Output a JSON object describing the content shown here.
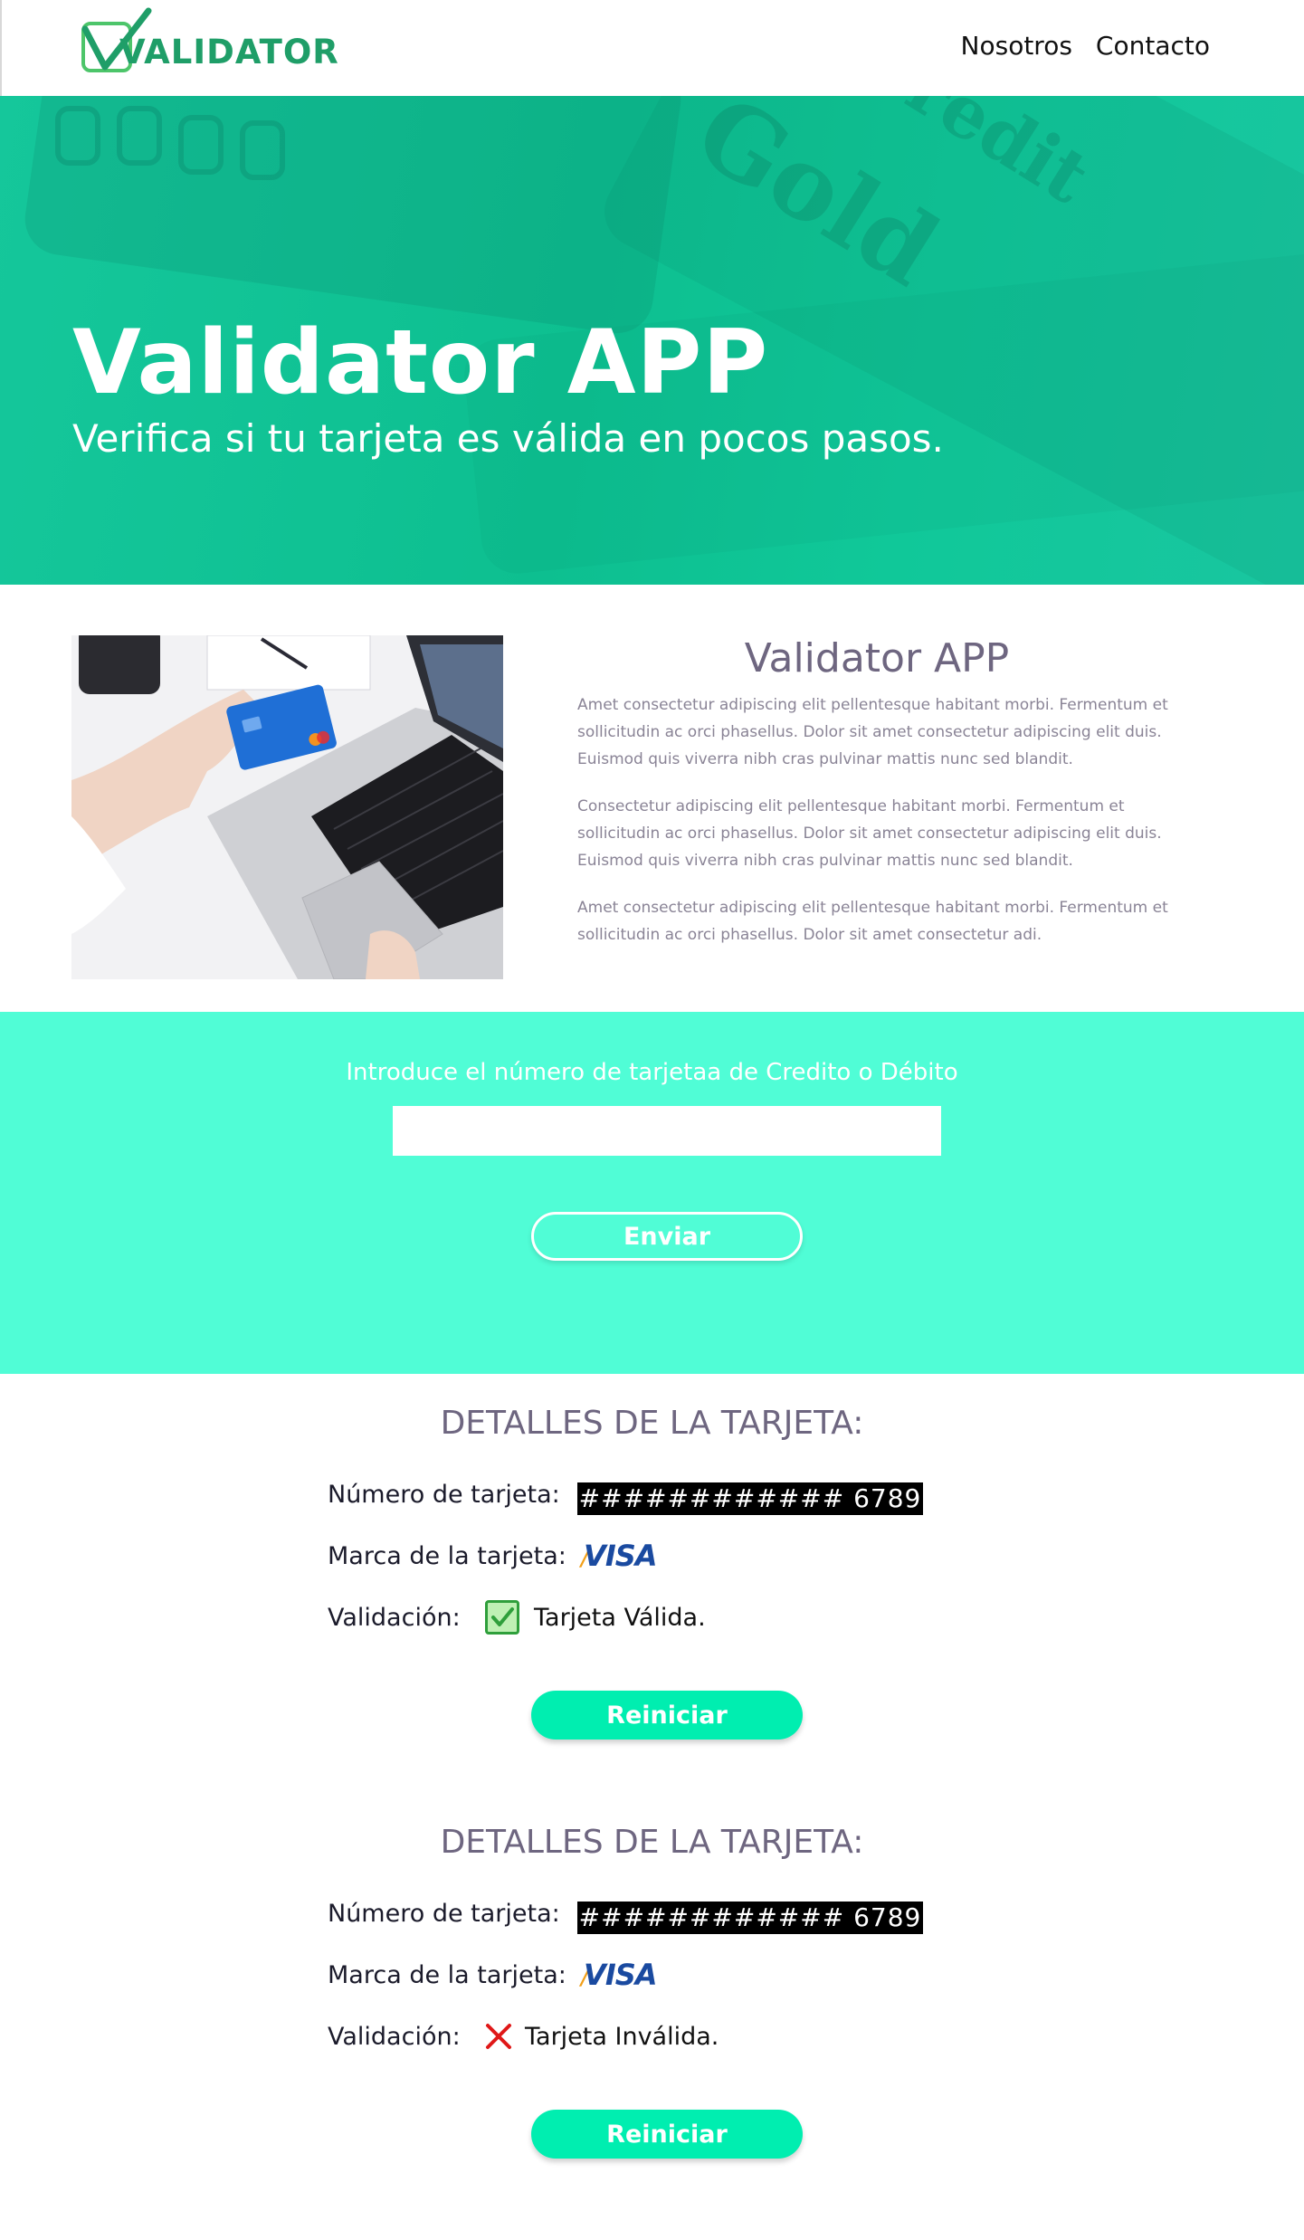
{
  "header": {
    "logo_text": "VALIDATOR",
    "nav": [
      "Nosotros",
      "Contacto"
    ]
  },
  "hero": {
    "title": "Validator APP",
    "subtitle": "Verifica si tu tarjeta es válida en pocos pasos.",
    "background_text": [
      "Gold",
      "credit"
    ]
  },
  "about": {
    "title": "Validator APP",
    "paragraphs": [
      "Amet consectetur adipiscing elit pellentesque habitant morbi. Fermentum et sollicitudin ac orci phasellus. Dolor sit amet consectetur adipiscing elit duis. Euismod quis viverra nibh cras pulvinar mattis nunc sed blandit.",
      "Consectetur adipiscing elit pellentesque habitant morbi. Fermentum et sollicitudin ac orci phasellus. Dolor sit amet consectetur adipiscing elit duis. Euismod quis viverra nibh cras pulvinar mattis nunc sed blandit.",
      "Amet consectetur adipiscing elit pellentesque habitant morbi. Fermentum et sollicitudin ac orci phasellus. Dolor sit amet consectetur adi."
    ]
  },
  "form": {
    "label": "Introduce el número de tarjetaa de Credito o Débito",
    "input_value": "",
    "submit_label": "Enviar"
  },
  "results": [
    {
      "title": "DETALLES DE LA TARJETA:",
      "number_label": "Número de tarjeta:",
      "number_value": "############ 6789",
      "brand_label": "Marca de la tarjeta:",
      "brand": "VISA",
      "validation_label": "Validación:",
      "validation_text": "Tarjeta Válida.",
      "valid": true,
      "reset_label": "Reiniciar"
    },
    {
      "title": "DETALLES DE LA TARJETA:",
      "number_label": "Número de tarjeta:",
      "number_value": "############ 6789",
      "brand_label": "Marca de la tarjeta:",
      "brand": "VISA",
      "validation_label": "Validación:",
      "validation_text": "Tarjeta Inválida.",
      "valid": false,
      "reset_label": "Reiniciar"
    }
  ],
  "colors": {
    "brand_green": "#1f9e68",
    "hero": "#0dbf90",
    "band": "#50fdd6",
    "button": "#00eeb0",
    "heading": "#6e6680"
  }
}
